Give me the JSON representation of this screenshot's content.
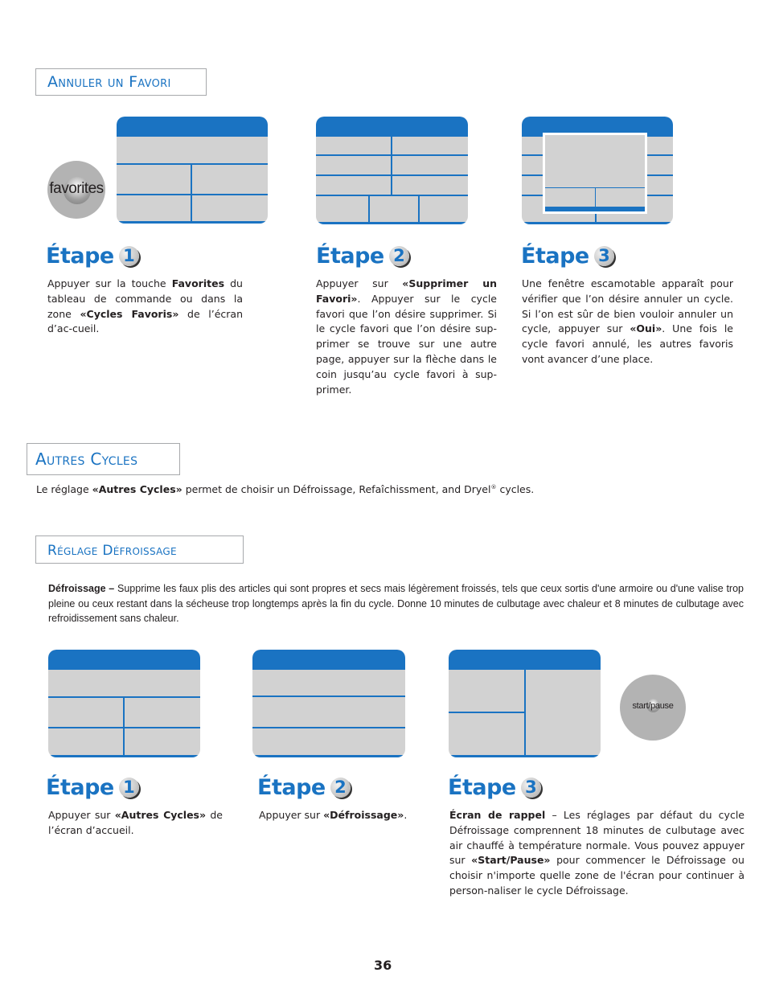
{
  "page_number": "36",
  "colors": {
    "accent": "#1a73c2",
    "screen_fill": "#d2d2d2",
    "button_gray": "#b3b3b3"
  },
  "sections": {
    "annuler": {
      "title": "Annuler un Favori"
    },
    "autres": {
      "title": "Autres Cycles",
      "intro_pre": "Le réglage ",
      "intro_bold": "«Autres Cycles»",
      "intro_post": " permet de choisir un Défroissage, Refaîchissment, and Dryel",
      "intro_sup": "®",
      "intro_end": " cycles."
    },
    "reglage": {
      "title": "Réglage Défroissage",
      "desc_bold": "Défroissage –",
      "desc": " Supprime les faux plis des articles qui sont propres et secs mais légèrement froissés, tels que ceux sortis d'une armoire ou d'une valise trop pleine ou ceux restant dans la sécheuse trop longtemps après la fin du cycle. Donne 10 minutes de culbutage avec chaleur et 8 minutes de culbutage avec refroidissement sans chaleur."
    }
  },
  "buttons": {
    "favorites": "favorites",
    "start_pause": "start/pause"
  },
  "steps_annuler": [
    {
      "label": "Étape",
      "num": "1",
      "t1": "Appuyer sur la touche ",
      "b1": "Favorites",
      "t2": " du tableau de commande ou dans la zone ",
      "b2": "«Cycles Favoris»",
      "t3": " de l’écran d’ac-cueil."
    },
    {
      "label": "Étape",
      "num": "2",
      "t1": "Appuyer sur ",
      "b1": "«Supprimer un Favori»",
      "t2": ".  Appuyer sur le cycle favori que l’on désire supprimer. Si le cycle favori que l’on désire sup-primer se trouve sur une autre page, appuyer sur la flèche dans le coin jusqu’au cycle favori à sup-primer."
    },
    {
      "label": "Étape",
      "num": "3",
      "t1": "Une fenêtre escamotable apparaît pour vérifier que l’on désire annuler un cycle. Si l’on est sûr de bien vouloir annuler un cycle, appuyer sur ",
      "b1": "«Oui»",
      "t2": ". Une fois le cycle favori annulé, les autres favoris vont avancer d’une place."
    }
  ],
  "steps_reglage": [
    {
      "label": "Étape",
      "num": "1",
      "t1": "Appuyer sur ",
      "b1": "«Autres Cycles»",
      "t2": " de l’écran d’accueil."
    },
    {
      "label": "Étape",
      "num": "2",
      "t1": "Appuyer sur ",
      "b1": "«Défroissage»",
      "t2": "."
    },
    {
      "label": "Étape",
      "num": "3",
      "b0": "Écran de rappel",
      "t1": " – Les réglages par défaut du cycle Défroissage comprennent 18 minutes de culbutage avec air chauffé à température normale. Vous pouvez appuyer sur ",
      "b1": "«Start/Pause»",
      "t2": " pour commencer le Défroissage ou choisir n'importe quelle zone de l'écran pour continuer à person-naliser le cycle Défroissage."
    }
  ]
}
